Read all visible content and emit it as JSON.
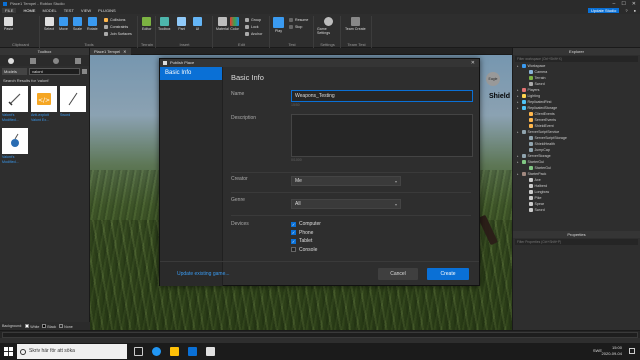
{
  "window": {
    "title": "Place1 Tempel - Roblox Studio"
  },
  "menubar": {
    "file": "FILE",
    "tabs": [
      "HOME",
      "MODEL",
      "TEST",
      "VIEW",
      "PLUGINS"
    ],
    "update_button": "Update Studio"
  },
  "ribbon": {
    "paste": "Paste",
    "clipboard_label": "Clipboard",
    "select": "Select",
    "move": "Move",
    "scale": "Scale",
    "rotate": "Rotate",
    "collisions": "Collisions",
    "constraints": "Constraints",
    "join_surfaces": "Join Surfaces",
    "tools_label": "Tools",
    "editor": "Editor",
    "terrain_label": "Terrain",
    "toolbox": "Toolbox",
    "part": "Part",
    "ui": "UI",
    "insert_label": "Insert",
    "material": "Material",
    "color": "Color",
    "group": "Group",
    "lock": "Lock",
    "anchor": "Anchor",
    "edit_label": "Edit",
    "play": "Play",
    "resume": "Resume",
    "stop": "Stop",
    "test_label": "Test",
    "game_settings": "Game Settings",
    "settings_label": "Settings",
    "team_create": "Team Create",
    "team_test_label": "Team Test"
  },
  "tabstrip": {
    "tab": "Place1 Tempel"
  },
  "toolbox": {
    "title": "Toolbox",
    "category": "Models",
    "search_value": "valont",
    "results_label": "Search Results for 'valont'",
    "items": [
      {
        "name": "Valont's Modified..."
      },
      {
        "name": "Anti-exploit Valont Ex..."
      },
      {
        "name": "Sword"
      },
      {
        "name": "Valont's Modified..."
      }
    ],
    "background_label": "Background:",
    "backgrounds": [
      "White",
      "Black",
      "None"
    ]
  },
  "viewport": {
    "shield_label": "Shield",
    "avatar_label": "Eagle"
  },
  "modal": {
    "title": "Publish Place",
    "sidebar_active": "Basic Info",
    "heading": "Basic Info",
    "name_label": "Name",
    "name_value": "Weapons_Testing",
    "name_counter": "15/50",
    "description_label": "Description",
    "description_counter": "0/1000",
    "creator_label": "Creator",
    "creator_value": "Me",
    "genre_label": "Genre",
    "genre_value": "All",
    "devices_label": "Devices",
    "devices": [
      {
        "label": "Computer",
        "checked": true
      },
      {
        "label": "Phone",
        "checked": true
      },
      {
        "label": "Tablet",
        "checked": true
      },
      {
        "label": "Console",
        "checked": false
      }
    ],
    "update_link": "Update existing game...",
    "cancel": "Cancel",
    "create": "Create"
  },
  "explorer": {
    "title": "Explorer",
    "filter_placeholder": "Filter workspace (Ctrl+Shift+X)",
    "items": [
      {
        "label": "Workspace",
        "depth": 0,
        "color": "#3a9af0"
      },
      {
        "label": "Camera",
        "depth": 1,
        "color": "#8ab4d8"
      },
      {
        "label": "Terrain",
        "depth": 1,
        "color": "#7cb342"
      },
      {
        "label": "Sword",
        "depth": 1,
        "color": "#aaa"
      },
      {
        "label": "Players",
        "depth": 0,
        "color": "#e57373"
      },
      {
        "label": "Lighting",
        "depth": 0,
        "color": "#ffd54f"
      },
      {
        "label": "ReplicatedFirst",
        "depth": 0,
        "color": "#4fc3f7"
      },
      {
        "label": "ReplicatedStorage",
        "depth": 0,
        "color": "#4fc3f7"
      },
      {
        "label": "ClientEvents",
        "depth": 1,
        "color": "#ffb74d"
      },
      {
        "label": "ServerEvents",
        "depth": 1,
        "color": "#ffb74d"
      },
      {
        "label": "ShieldEvent",
        "depth": 1,
        "color": "#ffb74d"
      },
      {
        "label": "ServerScriptService",
        "depth": 0,
        "color": "#90a4ae"
      },
      {
        "label": "ServerScriptStorage",
        "depth": 1,
        "color": "#90a4ae"
      },
      {
        "label": "ShieldHealth",
        "depth": 1,
        "color": "#90a4ae"
      },
      {
        "label": "JumpCap",
        "depth": 1,
        "color": "#90a4ae"
      },
      {
        "label": "ServerStorage",
        "depth": 0,
        "color": "#90a4ae"
      },
      {
        "label": "StarterGui",
        "depth": 0,
        "color": "#81c784"
      },
      {
        "label": "StarterGui",
        "depth": 1,
        "color": "#81c784"
      },
      {
        "label": "StarterPack",
        "depth": 0,
        "color": "#a1887f"
      },
      {
        "label": "Axe",
        "depth": 1,
        "color": "#ccc"
      },
      {
        "label": "Halberd",
        "depth": 1,
        "color": "#ccc"
      },
      {
        "label": "Longbow",
        "depth": 1,
        "color": "#ccc"
      },
      {
        "label": "Pike",
        "depth": 1,
        "color": "#ccc"
      },
      {
        "label": "Spear",
        "depth": 1,
        "color": "#ccc"
      },
      {
        "label": "Sword",
        "depth": 1,
        "color": "#ccc"
      }
    ]
  },
  "properties": {
    "title": "Properties",
    "filter_placeholder": "Filter Properties (Ctrl+Shift+P)"
  },
  "taskbar": {
    "search_placeholder": "Skriv här för att söka",
    "lang": "SWE",
    "time": "15:00",
    "date": "2020-09-04"
  },
  "colors": {
    "accent": "#0a70d6",
    "panel": "#2e2e2e",
    "link": "#3a9af0"
  }
}
